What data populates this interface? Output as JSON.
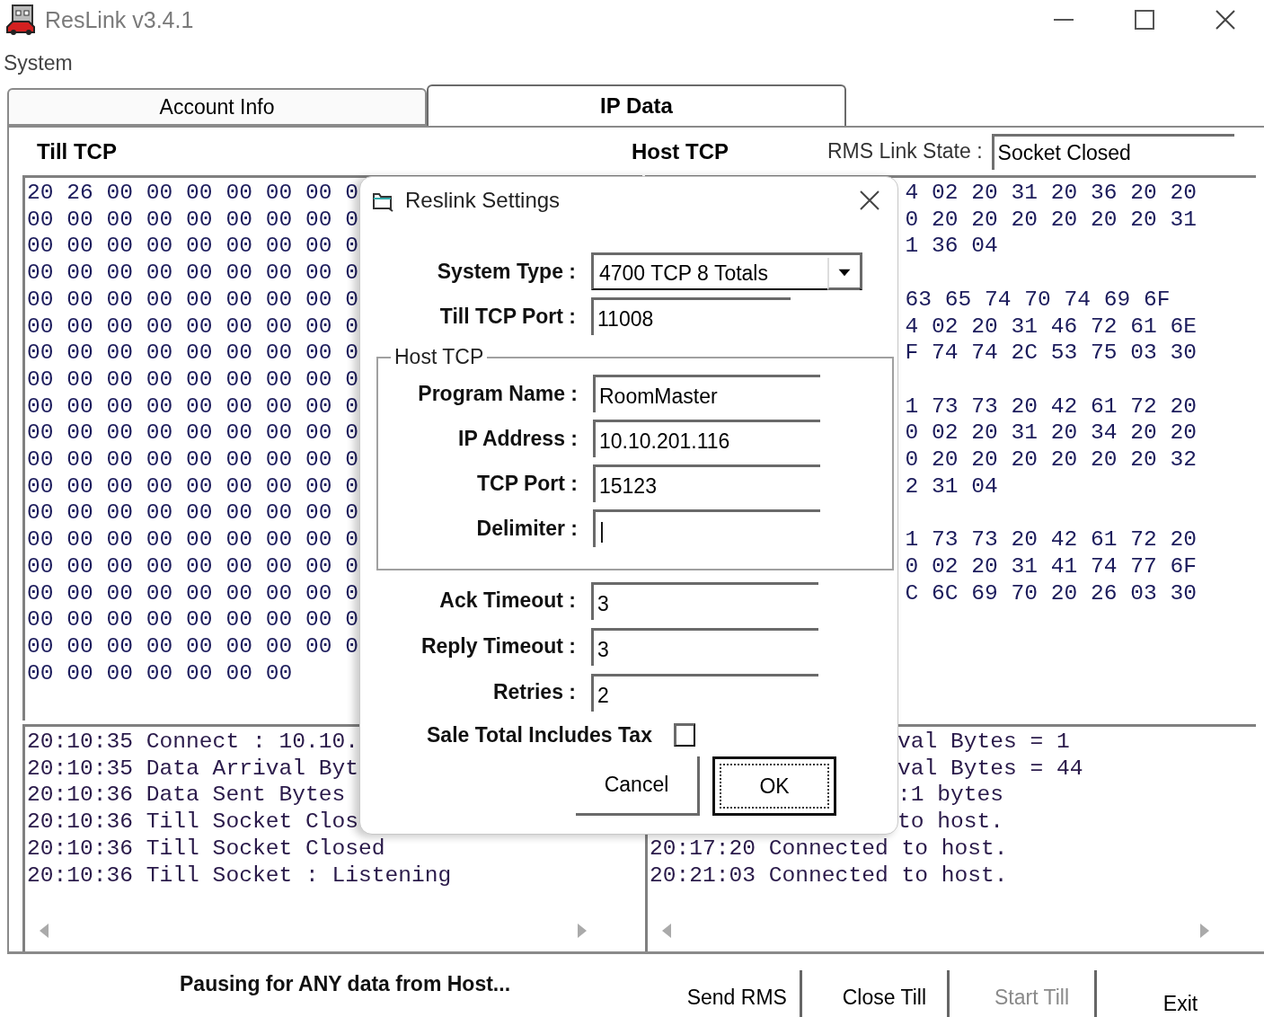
{
  "window": {
    "title": "ResLink v3.4.1"
  },
  "menu": [
    {
      "label": "System"
    }
  ],
  "tabs": [
    {
      "label": "Account Info",
      "selected": false
    },
    {
      "label": "IP Data",
      "selected": true
    }
  ],
  "till_tcp": {
    "title": "Till TCP",
    "hex_lines": [
      "20 26 00 00 00 00 00 00 0",
      "00 00 00 00 00 00 00 00 0",
      "00 00 00 00 00 00 00 00 0",
      "00 00 00 00 00 00 00 00 0",
      "00 00 00 00 00 00 00 00 0",
      "00 00 00 00 00 00 00 00 0",
      "00 00 00 00 00 00 00 00 0",
      "00 00 00 00 00 00 00 00 0",
      "00 00 00 00 00 00 00 00 0",
      "00 00 00 00 00 00 00 00 0",
      "00 00 00 00 00 00 00 00 0",
      "00 00 00 00 00 00 00 00 0",
      "00 00 00 00 00 00 00 00 0",
      "00 00 00 00 00 00 00 00 0",
      "00 00 00 00 00 00 00 00 0",
      "00 00 00 00 00 00 00 00 0",
      "00 00 00 00 00 00 00 00 0",
      "00 00 00 00 00 00 00 00 0",
      "00 00 00 00 00 00 00"
    ],
    "log_lines": [
      "20:10:35 Connect : 10.10.",
      "20:10:35 Data Arrival Byt",
      "20:10:36 Data Sent Bytes",
      "20:10:36 Till Socket Clos",
      "20:10:36 Till Socket Closed",
      "20:10:36 Till Socket : Listening"
    ]
  },
  "host_tcp": {
    "title": "Host TCP",
    "link_state_label": "RMS Link State :",
    "link_state": "Socket Closed",
    "hex_blocks": [
      [
        "4 02 20 31 20 36 20 20",
        "0 20 20 20 20 20 20 31",
        "1 36 04"
      ],
      [
        "63 65 74 70 74 69 6F",
        "4 02 20 31 46 72 61 6E",
        "F 74 74 2C 53 75 03 30"
      ],
      [
        "1 73 73 20 42 61 72 20",
        "0 02 20 31 20 34 20 20",
        "0 20 20 20 20 20 20 32",
        "2 31 04"
      ],
      [
        "1 73 73 20 42 61 72 20",
        "0 02 20 31 41 74 77 6F",
        "C 6C 69 70 20 26 03 30"
      ]
    ],
    "log_lines": [
      {
        "text": "val Bytes = 1",
        "kind": "tail"
      },
      {
        "text": "val Bytes = 44",
        "kind": "tail"
      },
      {
        "text": ":1 bytes",
        "kind": "tail"
      },
      {
        "text": "to host.",
        "kind": "tail"
      },
      {
        "text": "20:17:20 Connected to host.",
        "kind": "full"
      },
      {
        "text": "20:21:03 Connected to host.",
        "kind": "full"
      }
    ]
  },
  "status": "Pausing for ANY data from Host...",
  "buttons": [
    {
      "label": "Send RMS",
      "disabled": false
    },
    {
      "label": "Close Till",
      "disabled": false
    },
    {
      "label": "Start Till",
      "disabled": true
    },
    {
      "label": "Exit",
      "disabled": false
    }
  ],
  "dialog": {
    "title": "Reslink Settings",
    "fields": [
      {
        "label": "System Type :",
        "value": "4700 TCP 8 Totals",
        "kind": "dropdown"
      },
      {
        "label": "Till TCP Port :",
        "value": "11008",
        "kind": "short"
      }
    ],
    "group": {
      "title": "Host TCP",
      "fields": [
        {
          "label": "Program Name :",
          "value": "RoomMaster"
        },
        {
          "label": "IP Address :",
          "value": "10.10.201.116"
        },
        {
          "label": "TCP Port :",
          "value": "15123"
        },
        {
          "label": "Delimiter :",
          "value": "|"
        }
      ]
    },
    "more_fields": [
      {
        "label": "Ack Timeout :",
        "value": "3"
      },
      {
        "label": "Reply Timeout :",
        "value": "3"
      },
      {
        "label": "Retries :",
        "value": "2"
      }
    ],
    "checkbox": {
      "label": "Sale Total Includes Tax",
      "checked": false
    },
    "buttons": [
      {
        "label": "Cancel",
        "focused": false
      },
      {
        "label": "OK",
        "focused": true
      }
    ]
  }
}
